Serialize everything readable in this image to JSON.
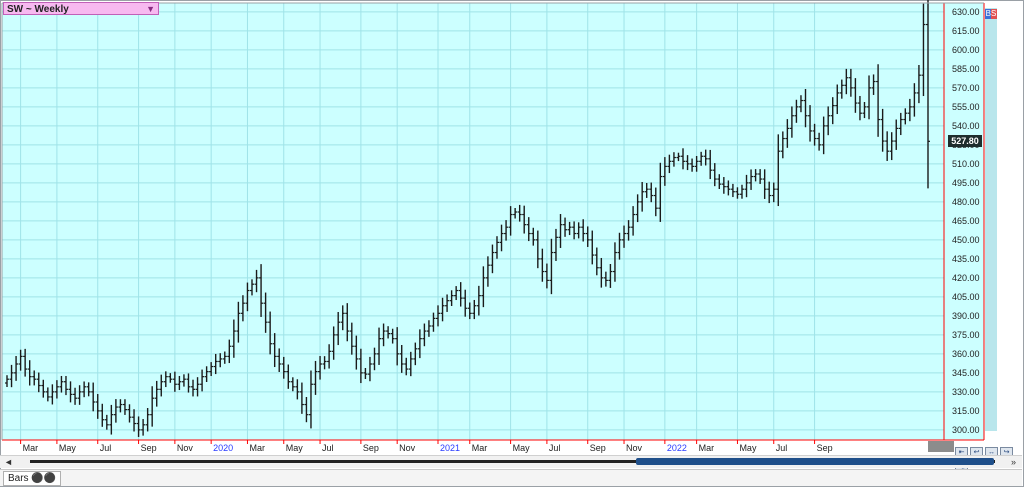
{
  "symbol": {
    "label": "SW ~ Weekly",
    "caret": "▼"
  },
  "last_price_label": "527.80",
  "badge_text": "BS",
  "bottom": {
    "tab_label": "Bars ⚫⚫"
  },
  "scroll": {
    "left_arrow": "◄",
    "right_arrow": "»"
  },
  "colors": {
    "plot_bg": "#ccffff",
    "grid": "#9fe3e8",
    "bars": "#1a1a1a",
    "axis_red": "#ff0000"
  },
  "chart_data": {
    "type": "ohlc",
    "title": "SW ~ Weekly",
    "ylim": [
      292,
      637
    ],
    "yticks": [
      300,
      315,
      330,
      345,
      360,
      375,
      390,
      405,
      420,
      435,
      450,
      465,
      480,
      495,
      510,
      525,
      540,
      555,
      570,
      585,
      600,
      615,
      630
    ],
    "ytick_labels": [
      "300.00",
      "315.00",
      "330.00",
      "345.00",
      "360.00",
      "375.00",
      "390.00",
      "405.00",
      "420.00",
      "435.00",
      "450.00",
      "465.00",
      "480.00",
      "495.00",
      "510.00",
      "525.00",
      "540.00",
      "555.00",
      "570.00",
      "585.00",
      "600.00",
      "615.00",
      "630.00"
    ],
    "last_price": 527.8,
    "xaxis_labels": [
      {
        "label": "Mar",
        "i": 3,
        "year": false
      },
      {
        "label": "May",
        "i": 11,
        "year": false
      },
      {
        "label": "Jul",
        "i": 20,
        "year": false
      },
      {
        "label": "Sep",
        "i": 29,
        "year": false
      },
      {
        "label": "Nov",
        "i": 37,
        "year": false
      },
      {
        "label": "2020",
        "i": 45,
        "year": true
      },
      {
        "label": "Mar",
        "i": 53,
        "year": false
      },
      {
        "label": "May",
        "i": 61,
        "year": false
      },
      {
        "label": "Jul",
        "i": 69,
        "year": false
      },
      {
        "label": "Sep",
        "i": 78,
        "year": false
      },
      {
        "label": "Nov",
        "i": 86,
        "year": false
      },
      {
        "label": "2021",
        "i": 95,
        "year": true
      },
      {
        "label": "Mar",
        "i": 102,
        "year": false
      },
      {
        "label": "May",
        "i": 111,
        "year": false
      },
      {
        "label": "Jul",
        "i": 119,
        "year": false
      },
      {
        "label": "Sep",
        "i": 128,
        "year": false
      },
      {
        "label": "Nov",
        "i": 136,
        "year": false
      },
      {
        "label": "2022",
        "i": 145,
        "year": true
      },
      {
        "label": "Mar",
        "i": 152,
        "year": false
      },
      {
        "label": "May",
        "i": 161,
        "year": false
      },
      {
        "label": "Jul",
        "i": 169,
        "year": false
      },
      {
        "label": "Sep",
        "i": 178,
        "year": false
      }
    ],
    "closes": [
      340,
      345,
      352,
      358,
      348,
      342,
      340,
      335,
      330,
      326,
      330,
      334,
      338,
      332,
      328,
      325,
      330,
      334,
      330,
      322,
      315,
      308,
      304,
      312,
      318,
      320,
      316,
      310,
      305,
      300,
      304,
      312,
      325,
      332,
      338,
      342,
      340,
      336,
      338,
      340,
      334,
      332,
      336,
      342,
      346,
      350,
      354,
      356,
      358,
      366,
      378,
      392,
      400,
      410,
      415,
      420,
      400,
      385,
      368,
      358,
      352,
      346,
      338,
      334,
      330,
      320,
      312,
      336,
      346,
      352,
      354,
      362,
      375,
      385,
      392,
      378,
      366,
      356,
      345,
      344,
      352,
      360,
      372,
      378,
      376,
      372,
      360,
      352,
      348,
      356,
      364,
      372,
      378,
      382,
      388,
      392,
      398,
      402,
      406,
      410,
      404,
      396,
      392,
      398,
      406,
      420,
      430,
      440,
      448,
      455,
      460,
      470,
      472,
      470,
      462,
      455,
      450,
      435,
      425,
      418,
      440,
      452,
      462,
      458,
      460,
      455,
      460,
      455,
      450,
      438,
      428,
      420,
      418,
      425,
      440,
      450,
      455,
      460,
      470,
      480,
      488,
      490,
      485,
      475,
      500,
      508,
      512,
      515,
      516,
      512,
      510,
      508,
      512,
      516,
      514,
      505,
      498,
      494,
      492,
      490,
      488,
      486,
      490,
      495,
      500,
      502,
      498,
      490,
      485,
      490,
      520,
      530,
      538,
      548,
      555,
      560,
      548,
      536,
      530,
      525,
      540,
      548,
      556,
      566,
      572,
      578,
      570,
      558,
      550,
      555,
      570,
      575,
      545,
      528,
      520,
      528,
      538,
      545,
      550,
      555,
      566,
      580,
      620,
      527.8
    ]
  }
}
